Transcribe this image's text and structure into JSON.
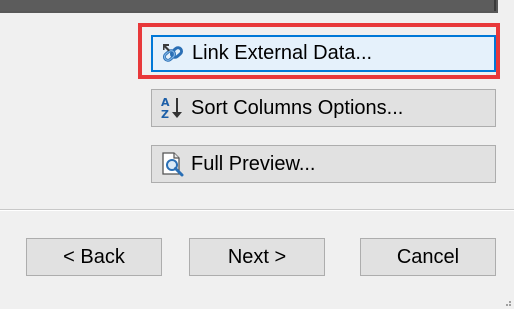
{
  "options": {
    "link_label": "Link External Data...",
    "link_icon": "link-icon",
    "sort_label": "Sort Columns Options...",
    "sort_icon": "sort-az-icon",
    "preview_label": "Full Preview...",
    "preview_icon": "preview-icon"
  },
  "navigation": {
    "back_label": "< Back",
    "next_label": "Next >",
    "cancel_label": "Cancel"
  },
  "colors": {
    "highlight": "#e8383a",
    "focus_border": "#0078d7",
    "button_face": "#e1e1e1",
    "dialog_bg": "#f0f0f0"
  }
}
